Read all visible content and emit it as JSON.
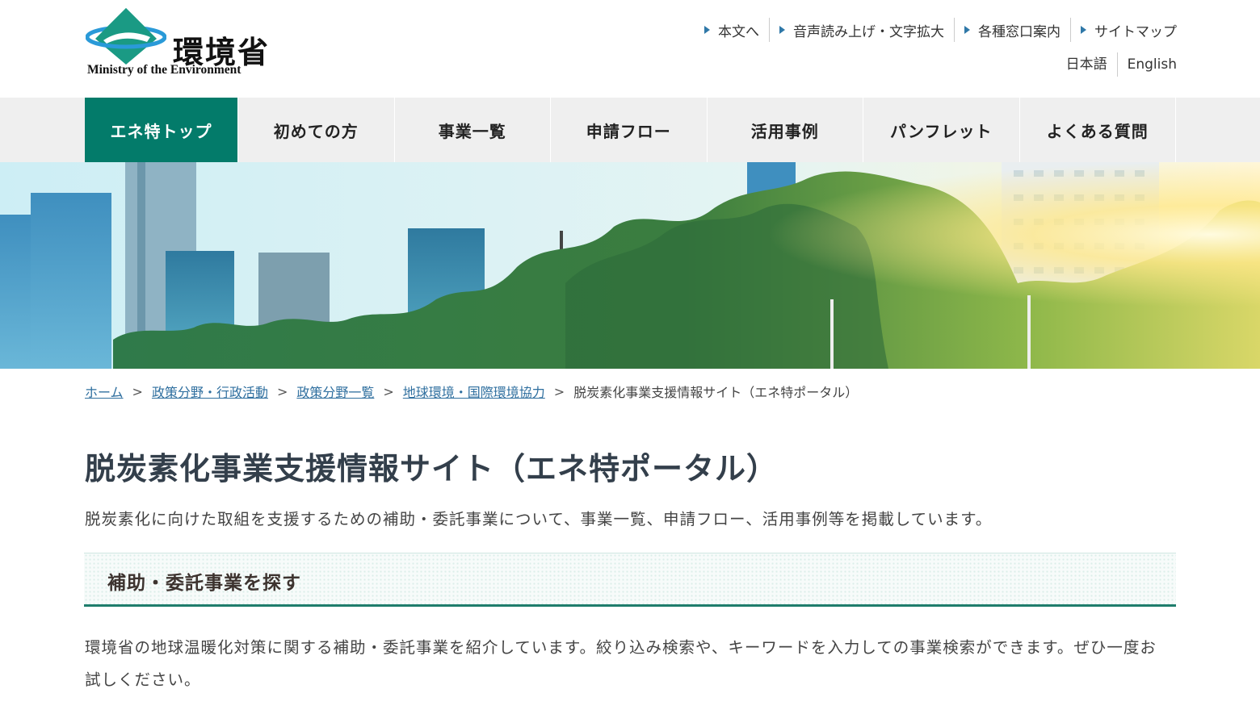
{
  "header": {
    "logo": {
      "jp": "環境省",
      "en": "Ministry of the Environment",
      "mark_icon": "ministry-of-environment-emblem-icon",
      "mark_colors": {
        "diamond": "#1a9a84",
        "ring": "#2a9ad8"
      }
    },
    "utility_links": [
      {
        "label": "本文へ",
        "icon": "triangle-right-icon"
      },
      {
        "label": "音声読み上げ・文字拡大",
        "icon": "triangle-right-icon"
      },
      {
        "label": "各種窓口案内",
        "icon": "triangle-right-icon"
      },
      {
        "label": "サイトマップ",
        "icon": "triangle-right-icon"
      }
    ],
    "languages": [
      {
        "label": "日本語"
      },
      {
        "label": "English"
      }
    ]
  },
  "global_nav": {
    "items": [
      {
        "label": "エネ特トップ",
        "active": true
      },
      {
        "label": "初めての方",
        "active": false
      },
      {
        "label": "事業一覧",
        "active": false
      },
      {
        "label": "申請フロー",
        "active": false
      },
      {
        "label": "活用事例",
        "active": false
      },
      {
        "label": "パンフレット",
        "active": false
      },
      {
        "label": "よくある質問",
        "active": false
      }
    ],
    "accent_color": "#037b6a"
  },
  "hero": {
    "image_description": "City skyline with glass skyscrapers and green trees in sunlight"
  },
  "breadcrumb": {
    "links": [
      "ホーム",
      "政策分野・行政活動",
      "政策分野一覧",
      "地球環境・国際環境協力"
    ],
    "separator": ">",
    "current": "脱炭素化事業支援情報サイト（エネ特ポータル）"
  },
  "main": {
    "title": "脱炭素化事業支援情報サイト（エネ特ポータル）",
    "lead": "脱炭素化に向けた取組を支援するための補助・委託事業について、事業一覧、申請フロー、活用事例等を掲載しています。",
    "section": {
      "title": "補助・委託事業を探す",
      "body": "環境省の地球温暖化対策に関する補助・委託事業を紹介しています。絞り込み検索や、キーワードを入力しての事業検索ができます。ぜひ一度お試しください。"
    }
  }
}
